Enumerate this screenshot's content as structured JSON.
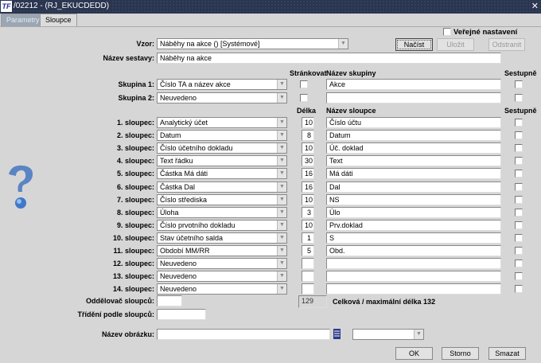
{
  "window": {
    "title": "/02212 - (RJ_EKUCDEDD)",
    "close": "✕"
  },
  "tabs": [
    {
      "label": "Parametry",
      "active": false
    },
    {
      "label": "Sloupce",
      "active": true
    }
  ],
  "form": {
    "vzor_label": "Vzor:",
    "vzor_value": "Náběhy na akce   ()   [Systémové]",
    "public_label": "Veřejné nastavení",
    "public_checked": false,
    "load_button": "Načíst",
    "save_button": "Uložit",
    "delete_button": "Odstranit",
    "report_name_label": "Název sestavy:",
    "report_name_value": "Náběhy na akce",
    "paging_header": "Stránkovat",
    "group_name_header": "Název skupiny",
    "descending_header": "Sestupně",
    "groups": [
      {
        "label": "Skupina 1:",
        "value": "Číslo TA a název akce",
        "paging": false,
        "name": "Akce",
        "descending": false
      },
      {
        "label": "Skupina 2:",
        "value": "Neuvedeno",
        "paging": false,
        "name": "",
        "descending": false
      }
    ],
    "length_header": "Délka",
    "column_name_header": "Název sloupce",
    "col_descending_header": "Sestupně",
    "columns": [
      {
        "label": "1. sloupec:",
        "value": "Analytický účet",
        "length": "10",
        "name": "Číslo účtu",
        "descending": false
      },
      {
        "label": "2. sloupec:",
        "value": "Datum",
        "length": "8",
        "name": "Datum",
        "descending": false
      },
      {
        "label": "3. sloupec:",
        "value": "Číslo účetního dokladu",
        "length": "10",
        "name": "Úč. doklad",
        "descending": false
      },
      {
        "label": "4. sloupec:",
        "value": "Text řádku",
        "length": "30",
        "name": "Text",
        "descending": false
      },
      {
        "label": "5. sloupec:",
        "value": "Částka Má dáti",
        "length": "16",
        "name": "Má dáti",
        "descending": false
      },
      {
        "label": "6. sloupec:",
        "value": "Částka Dal",
        "length": "16",
        "name": "Dal",
        "descending": false
      },
      {
        "label": "7. sloupec:",
        "value": "Číslo střediska",
        "length": "10",
        "name": "NS",
        "descending": false
      },
      {
        "label": "8. sloupec:",
        "value": "Úloha",
        "length": "3",
        "name": "Úlo",
        "descending": false
      },
      {
        "label": "9. sloupec:",
        "value": "Číslo prvotního dokladu",
        "length": "10",
        "name": "Prv.doklad",
        "descending": false
      },
      {
        "label": "10. sloupec:",
        "value": "Stav účetního salda",
        "length": "1",
        "name": "S",
        "descending": false
      },
      {
        "label": "11. sloupec:",
        "value": "Období MM/RR",
        "length": "5",
        "name": "Obd.",
        "descending": false
      },
      {
        "label": "12. sloupec:",
        "value": "Neuvedeno",
        "length": "",
        "name": "",
        "descending": false
      },
      {
        "label": "13. sloupec:",
        "value": "Neuvedeno",
        "length": "",
        "name": "",
        "descending": false
      },
      {
        "label": "14. sloupec:",
        "value": "Neuvedeno",
        "length": "",
        "name": "",
        "descending": false
      }
    ],
    "separator_label": "Oddělovač sloupců:",
    "separator_value": "",
    "total_length": "129",
    "total_text": "Celková / maximální délka 132",
    "sort_label": "Třídění podle sloupců:",
    "sort_value": "",
    "image_label": "Název obrázku:",
    "image_value": "",
    "image_select_value": "",
    "ok_button": "OK",
    "cancel_button": "Storno",
    "clear_button": "Smazat"
  },
  "colors": {
    "titlebar": "#2a3550",
    "background": "#d6d6d6"
  }
}
